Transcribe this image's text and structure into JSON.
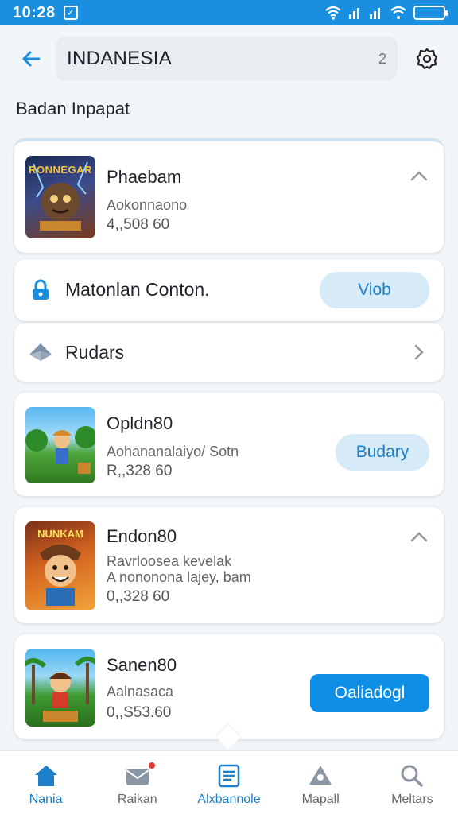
{
  "status_bar": {
    "time": "10:28",
    "check_glyph": "✓"
  },
  "search": {
    "value": "INDANESIA",
    "counter": "2"
  },
  "section_title": "Badan Inpapat",
  "cards": [
    {
      "name": "Phaebam",
      "subtitle": "Aokonnaono",
      "price": "4,,508 60",
      "thumb_caption": "RONNEGAR",
      "expanded": true
    },
    {
      "name": "Opldn80",
      "subtitle": "Aohananalaiyo/ Sotn",
      "price": "R,,328 60",
      "action": "Budary",
      "thumb_caption": ""
    },
    {
      "name": "Endon80",
      "subtitle": "Ravrloosea kevelak",
      "subtitle2": "A nononona lajey, bam",
      "price": "0,,328 60",
      "thumb_caption": "NUNKAM",
      "expanded": true
    },
    {
      "name": "Sanen80",
      "subtitle": "Aalnasaca",
      "price": "0,,S53.60",
      "action": "Oaliadogl",
      "thumb_caption": ""
    }
  ],
  "rows": [
    {
      "label": "Matonlan Conton.",
      "action": "Viob",
      "icon": "lock-icon"
    },
    {
      "label": "Rudars",
      "icon": "nav-arrow-icon"
    }
  ],
  "bottom_nav": [
    {
      "label": "Nania",
      "icon": "home-icon",
      "active": true
    },
    {
      "label": "Raikan",
      "icon": "mail-icon",
      "badge": true
    },
    {
      "label": "Alxbannole",
      "icon": "list-icon",
      "active": true
    },
    {
      "label": "Mapall",
      "icon": "map-icon"
    },
    {
      "label": "Meltars",
      "icon": "search-icon"
    }
  ],
  "colors": {
    "accent": "#1a8fe0",
    "primary_button": "#0f8ee6",
    "pill_bg": "#d6eaf8",
    "badge": "#e53935"
  }
}
